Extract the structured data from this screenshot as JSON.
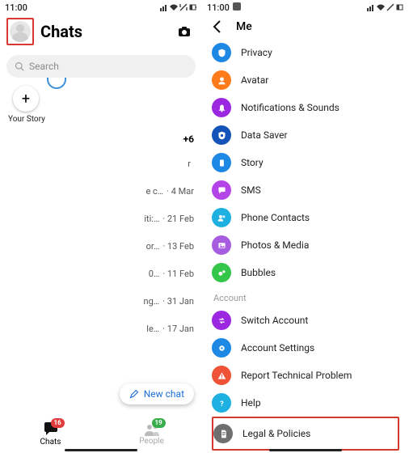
{
  "left": {
    "status_time": "11:00",
    "title": "Chats",
    "search_placeholder": "Search",
    "story_label": "Your Story",
    "plus_count": "+6",
    "chats": [
      {
        "preview": "r",
        "date": ""
      },
      {
        "preview": "e c…",
        "date": "4 Mar"
      },
      {
        "preview": "iti:…",
        "date": "21 Feb"
      },
      {
        "preview": "or…",
        "date": "13 Feb"
      },
      {
        "preview": "0…",
        "date": "11 Feb"
      },
      {
        "preview": "ng…",
        "date": "31 Jan"
      },
      {
        "preview": "le…",
        "date": "17 Jan"
      }
    ],
    "new_chat_label": "New chat",
    "nav": {
      "chats": {
        "label": "Chats",
        "badge": "16"
      },
      "people": {
        "label": "People",
        "badge": "19"
      }
    }
  },
  "right": {
    "status_time": "11:00",
    "title": "Me",
    "items": [
      {
        "label": "Privacy"
      },
      {
        "label": "Avatar"
      },
      {
        "label": "Notifications & Sounds"
      },
      {
        "label": "Data Saver"
      },
      {
        "label": "Story"
      },
      {
        "label": "SMS"
      },
      {
        "label": "Phone Contacts"
      },
      {
        "label": "Photos & Media"
      },
      {
        "label": "Bubbles"
      }
    ],
    "account_label": "Account",
    "account_items": [
      {
        "label": "Switch Account"
      },
      {
        "label": "Account Settings"
      },
      {
        "label": "Report Technical Problem"
      },
      {
        "label": "Help"
      },
      {
        "label": "Legal & Policies"
      }
    ]
  }
}
